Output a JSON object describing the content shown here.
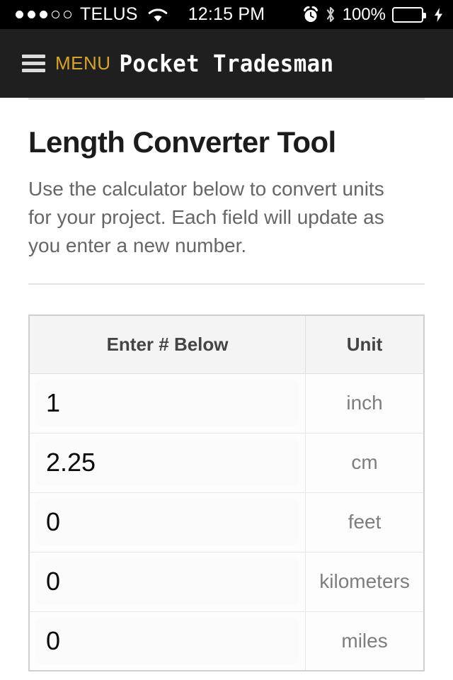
{
  "status_bar": {
    "carrier": "TELUS",
    "signal_dots_filled": 3,
    "signal_dots_total": 5,
    "wifi_icon": "wifi-icon",
    "time": "12:15 PM",
    "alarm_icon": "alarm-clock-icon",
    "bluetooth_icon": "bluetooth-icon",
    "battery_percent": "100%",
    "battery_color": "#4cd964",
    "charging_icon": "lightning-bolt-icon"
  },
  "header": {
    "menu_icon": "hamburger-menu-icon",
    "menu_label": "MENU",
    "menu_label_color": "#d6a527",
    "app_title": "Pocket Tradesman"
  },
  "main": {
    "page_title": "Length Converter Tool",
    "description": "Use the calculator below to convert units for your project. Each field will update as you enter a new number.",
    "table": {
      "columns": [
        "Enter # Below",
        "Unit"
      ],
      "rows": [
        {
          "value": "1",
          "unit": "inch"
        },
        {
          "value": "2.25",
          "unit": "cm"
        },
        {
          "value": "0",
          "unit": "feet"
        },
        {
          "value": "0",
          "unit": "kilometers"
        },
        {
          "value": "0",
          "unit": "miles"
        }
      ]
    }
  }
}
